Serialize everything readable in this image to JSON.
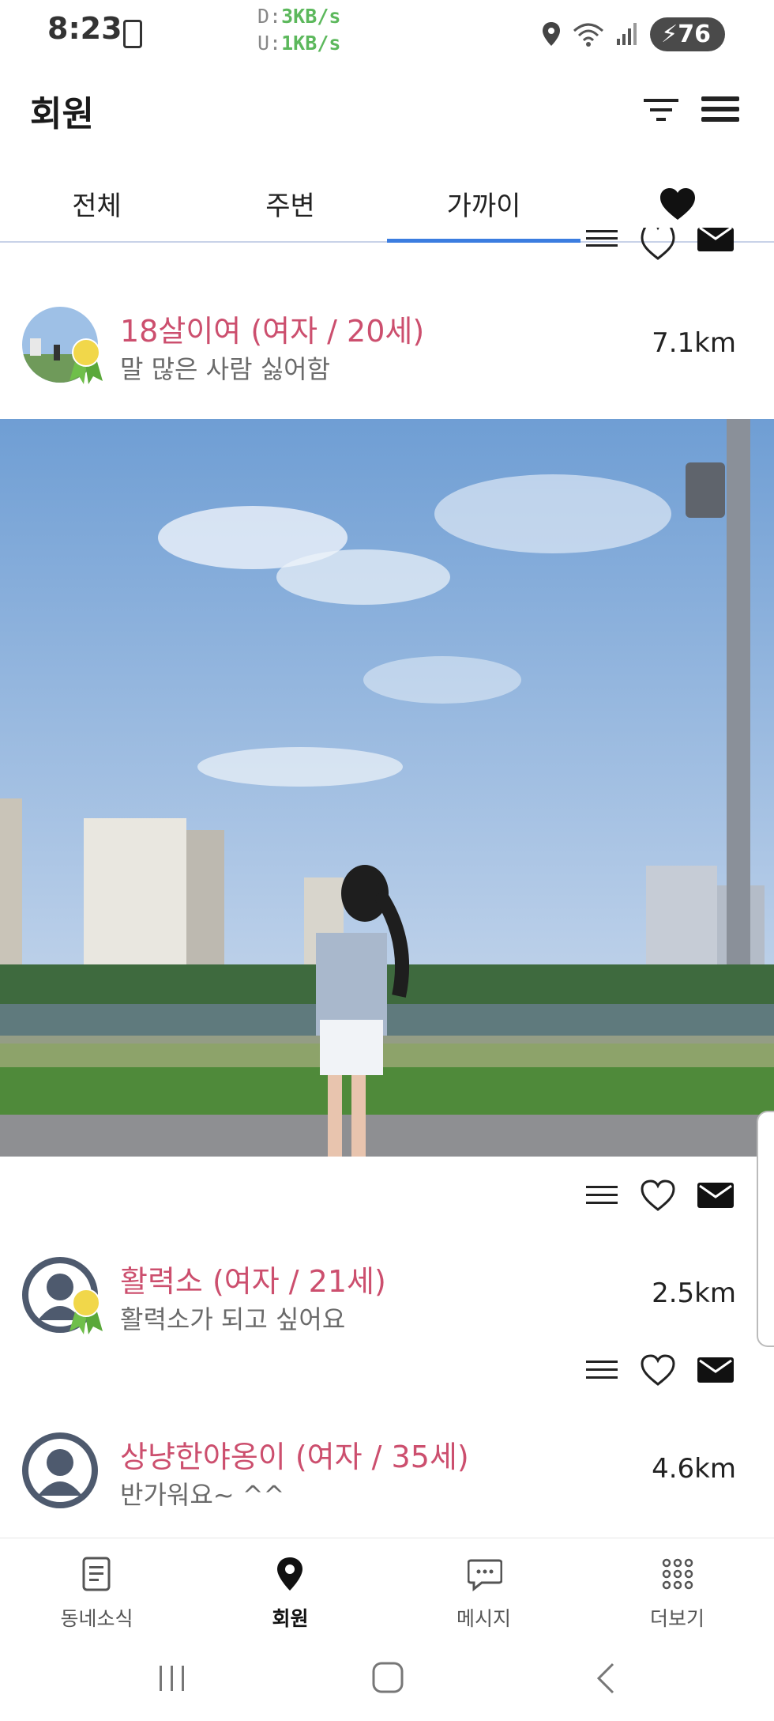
{
  "status_bar": {
    "time": "8:23",
    "download_label": "D:",
    "download_value": "3KB/s",
    "upload_label": "U:",
    "upload_value": "1KB/s",
    "battery": "76"
  },
  "header": {
    "title": "회원"
  },
  "tabs": [
    {
      "label": "전체"
    },
    {
      "label": "주변"
    },
    {
      "label": "가까이",
      "active": true
    },
    {
      "icon": "heart-icon"
    }
  ],
  "members": [
    {
      "name": "18살이여 (여자 / 20세)",
      "intro": "말 많은 사람 싫어함",
      "distance": "7.1km"
    },
    {
      "name": "활력소 (여자 / 21세)",
      "intro": "활력소가 되고 싶어요",
      "distance": "2.5km"
    },
    {
      "name": "상냥한야옹이 (여자 / 35세)",
      "intro": "반가워요~ ^^",
      "distance": "4.6km"
    }
  ],
  "bottom_nav": [
    {
      "label": "동네소식",
      "icon": "news-icon"
    },
    {
      "label": "회원",
      "icon": "location-pin-icon",
      "active": true
    },
    {
      "label": "메시지",
      "icon": "chat-icon"
    },
    {
      "label": "더보기",
      "icon": "grid-icon"
    }
  ],
  "colors": {
    "name": "#cc4f6e",
    "tab_indicator": "#3b7de0"
  }
}
